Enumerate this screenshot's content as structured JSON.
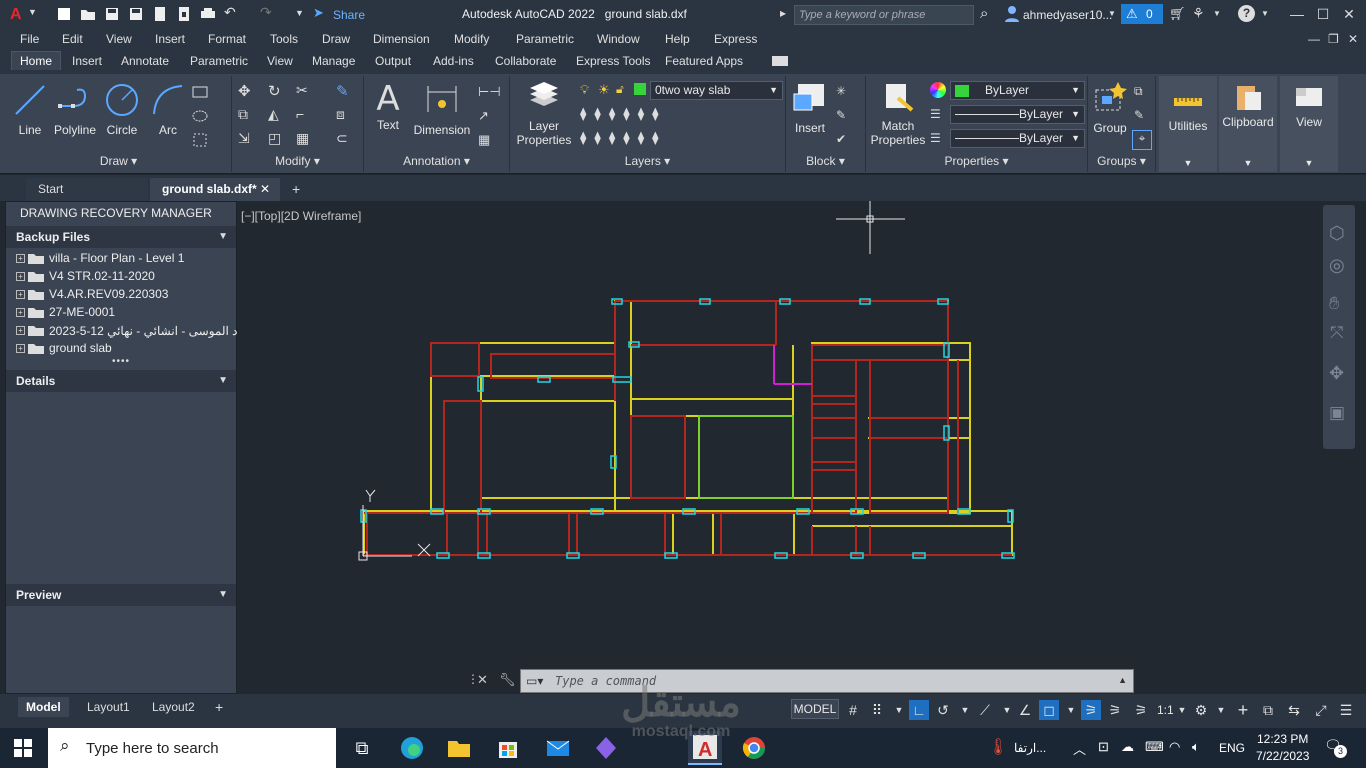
{
  "title_bar": {
    "app_title": "Autodesk AutoCAD 2022",
    "file_name": "ground slab.dxf",
    "share_label": "Share",
    "search_placeholder": "Type a keyword or phrase",
    "user_name": "ahmedyaser10...",
    "alert_count": "0"
  },
  "menu": [
    "File",
    "Edit",
    "View",
    "Insert",
    "Format",
    "Tools",
    "Draw",
    "Dimension",
    "Modify",
    "Parametric",
    "Window",
    "Help",
    "Express"
  ],
  "ribbon_tabs": [
    "Home",
    "Insert",
    "Annotate",
    "Parametric",
    "View",
    "Manage",
    "Output",
    "Add-ins",
    "Collaborate",
    "Express Tools",
    "Featured Apps"
  ],
  "ribbon": {
    "draw": {
      "title": "Draw",
      "line": "Line",
      "polyline": "Polyline",
      "circle": "Circle",
      "arc": "Arc"
    },
    "modify": {
      "title": "Modify"
    },
    "annotation": {
      "title": "Annotation",
      "text": "Text",
      "dimension": "Dimension"
    },
    "layers": {
      "title": "Layers",
      "layer_properties_1": "Layer",
      "layer_properties_2": "Properties",
      "current_layer": "0two way slab",
      "layer_color": "#34d43a"
    },
    "block": {
      "title": "Block",
      "insert": "Insert"
    },
    "properties": {
      "title": "Properties",
      "match_1": "Match",
      "match_2": "Properties",
      "color": "ByLayer",
      "linetype": "ByLayer",
      "lineweight": "ByLayer",
      "color_swatch": "#34d43a"
    },
    "groups": {
      "title": "Groups",
      "group": "Group"
    },
    "utilities": "Utilities",
    "clipboard": "Clipboard",
    "view": "View"
  },
  "doc_tabs": {
    "start": "Start",
    "active": "ground slab.dxf*"
  },
  "recovery": {
    "title": "DRAWING RECOVERY MANAGER",
    "backup_header": "Backup Files",
    "files": [
      "villa  - Floor Plan - Level 1",
      "V4 STR.02-11-2020",
      "V4.AR.REV09.220303",
      "27-ME-0001",
      "د الموسى - انشائي - نهائي 12-5-2023",
      "ground slab"
    ],
    "details_header": "Details",
    "preview_header": "Preview"
  },
  "viewport": {
    "label": "[−][Top][2D Wireframe]",
    "ucs_y": "Y"
  },
  "command": {
    "placeholder": "Type a command"
  },
  "layout_tabs": [
    "Model",
    "Layout1",
    "Layout2"
  ],
  "status": {
    "model": "MODEL",
    "scale": "1:1"
  },
  "taskbar": {
    "search_placeholder": "Type here to search",
    "weather": "ارتفا...",
    "lang": "ENG",
    "time": "12:23 PM",
    "date": "7/22/2023",
    "notifications": "3"
  },
  "watermark": {
    "line1": "مستقل",
    "line2": "mostaql.com"
  },
  "colors": {
    "wall_red": "#b3261e",
    "wall_yellow": "#d8d21e",
    "column_cyan": "#22d6e4",
    "green": "#7ed12a",
    "magenta": "#d21ed4"
  }
}
